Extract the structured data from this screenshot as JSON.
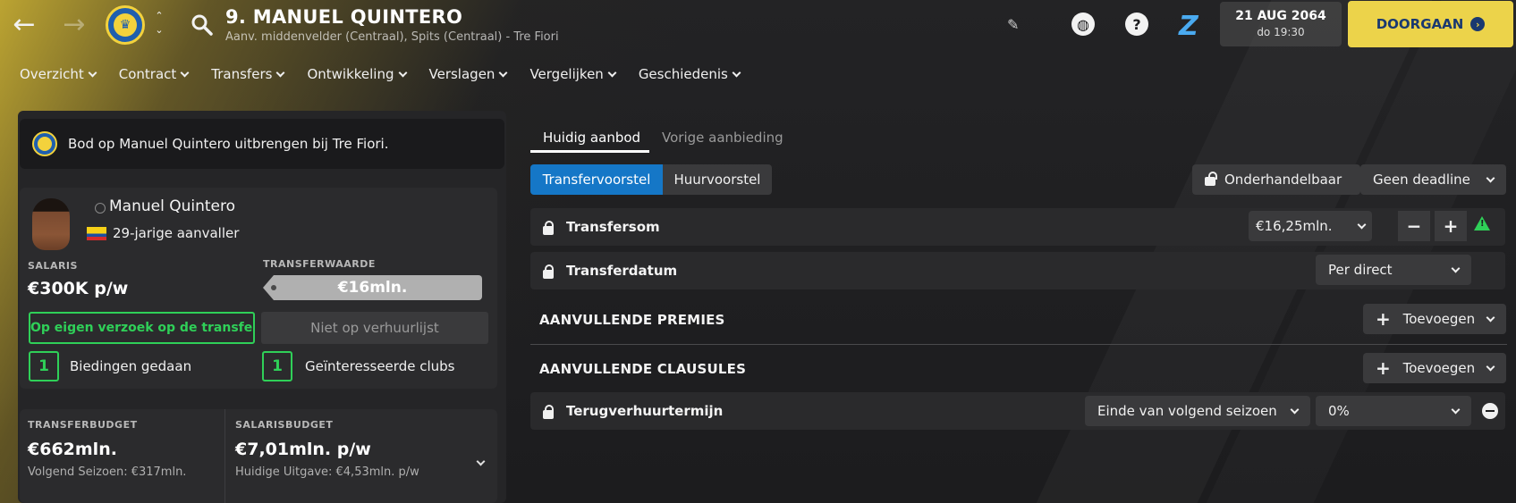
{
  "header": {
    "title": "9. MANUEL QUINTERO",
    "subtitle": "Aanv. middenvelder (Centraal), Spits (Centraal) - Tre Fiori",
    "date": "21 AUG 2064",
    "time": "do 19:30",
    "continue_label": "DOORGAAN"
  },
  "nav": [
    "Overzicht",
    "Contract",
    "Transfers",
    "Ontwikkeling",
    "Verslagen",
    "Vergelijken",
    "Geschiedenis"
  ],
  "left": {
    "offer_banner": "Bod op Manuel Quintero uitbrengen bij Tre Fiori.",
    "player_name": "Manuel Quintero",
    "player_age": "29-jarige aanvaller",
    "salary_label": "SALARIS",
    "salary_value": "€300K p/w",
    "transfer_value_label": "TRANSFERWAARDE",
    "transfer_value": "€16mln.",
    "listed_status": "Op eigen verzoek op de transfe…",
    "loan_status": "Niet op verhuurlijst",
    "bids_count": "1",
    "bids_label": "Biedingen gedaan",
    "interested_count": "1",
    "interested_label": "Geïnteresseerde clubs",
    "transfer_budget_label": "TRANSFERBUDGET",
    "transfer_budget_value": "€662mln.",
    "transfer_budget_next": "Volgend Seizoen: €317mln.",
    "wage_budget_label": "SALARISBUDGET",
    "wage_budget_value": "€7,01mln. p/w",
    "wage_budget_current": "Huidige Uitgave: €4,53mln. p/w"
  },
  "right": {
    "tab_current": "Huidig aanbod",
    "tab_previous": "Vorige aanbieding",
    "seg_transfer": "Transfervoorstel",
    "seg_loan": "Huurvoorstel",
    "negotiable": "Onderhandelbaar",
    "deadline": "Geen deadline",
    "fee_label": "Transfersom",
    "fee_value": "€16,25mln.",
    "date_label": "Transferdatum",
    "date_value": "Per direct",
    "bonuses_header": "AANVULLENDE PREMIES",
    "clauses_header": "AANVULLENDE CLAUSULES",
    "add_label": "Toevoegen",
    "loanback_label": "Terugverhuurtermijn",
    "loanback_period": "Einde van volgend seizoen",
    "loanback_pct": "0%"
  },
  "colors": {
    "accent_yellow": "#ecd34a",
    "accent_blue": "#1577c7",
    "status_green": "#2fd058"
  }
}
